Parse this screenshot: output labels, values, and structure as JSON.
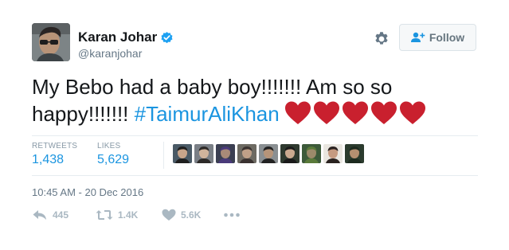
{
  "user": {
    "name": "Karan Johar",
    "handle": "@karanjohar",
    "verified_color": "#1da1f2"
  },
  "follow_button": {
    "label": "Follow"
  },
  "tweet": {
    "text_line1": "My Bebo had a baby boy!!!!!!! Am so so",
    "text_line2_prefix": "happy!!!!!!! ",
    "hashtag": "#TaimurAliKhan",
    "hearts_count": 5,
    "heart_color": "#c9202e"
  },
  "stats": {
    "retweets_label": "RETWEETS",
    "retweets_value": "1,438",
    "likes_label": "LIKES",
    "likes_value": "5,629",
    "liker_avatar_count": 9
  },
  "timestamp": "10:45 AM - 20 Dec 2016",
  "actions": {
    "reply_count": "445",
    "retweet_count": "1.4K",
    "like_count": "5.6K"
  },
  "colors": {
    "link": "#1b95e0",
    "muted": "#657786",
    "action_gray": "#aab8c2"
  }
}
